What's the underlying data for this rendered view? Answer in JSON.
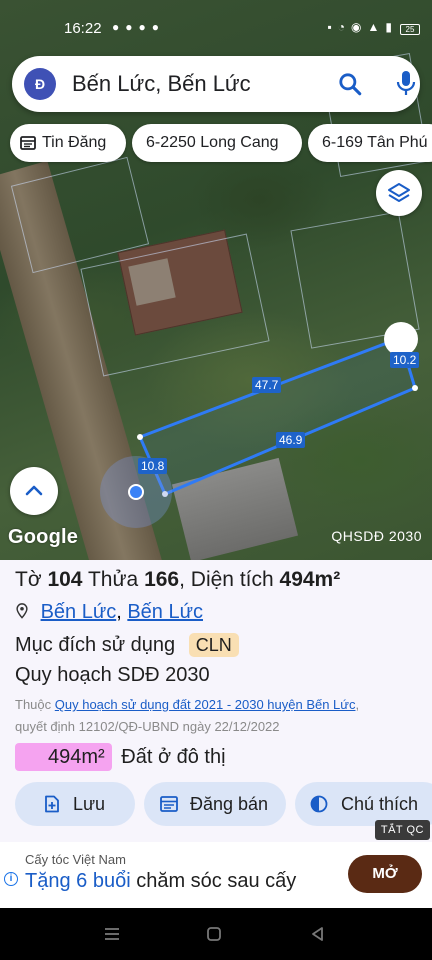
{
  "status_bar": {
    "time": "16:22",
    "battery": "25"
  },
  "search": {
    "avatar_letter": "Đ",
    "query": "Bến Lức, Bến Lức"
  },
  "chips": [
    {
      "label": "Tin Đăng"
    },
    {
      "label": "6-2250 Long Cang"
    },
    {
      "label": "6-169 Tân Phú"
    }
  ],
  "map": {
    "measurements": [
      "47.7",
      "10.2",
      "46.9",
      "10.8"
    ],
    "logo": "Google",
    "layer_tag": "QHSDĐ 2030"
  },
  "parcel": {
    "to_label": "Tờ",
    "to_value": "104",
    "thua_label": "Thửa",
    "thua_value": "166",
    "area_label": "Diện tích",
    "area_value": "494m²",
    "address_part1": "Bến Lức",
    "address_part2": "Bến Lức",
    "purpose_label": "Mục đích sử dụng",
    "purpose_code": "CLN",
    "plan_title": "Quy hoạch SDĐ 2030",
    "plan_prefix": "Thuộc",
    "plan_link": "Quy hoạch sử dụng đất 2021 - 2030 huyện Bến Lức",
    "plan_decision": "quyết định 12102/QĐ-UBND ngày 22/12/2022",
    "area_badge": "494m²",
    "area_type": "Đất ở đô thị"
  },
  "actions": {
    "save": "Lưu",
    "post": "Đăng bán",
    "legend": "Chú thích"
  },
  "ad": {
    "close_label": "TẮT QC",
    "sponsor": "Cấy tóc Việt Nam",
    "headline_highlight": "Tặng 6 buổi",
    "headline_rest": "chăm sóc sau cấy",
    "cta": "MỞ"
  },
  "colors": {
    "accent": "#1a5dc7",
    "parcel_outline": "#2f7bf5",
    "cta": "#5a2a14",
    "area_badge": "#f5a3f0",
    "purpose_badge": "#f9dfb3"
  }
}
